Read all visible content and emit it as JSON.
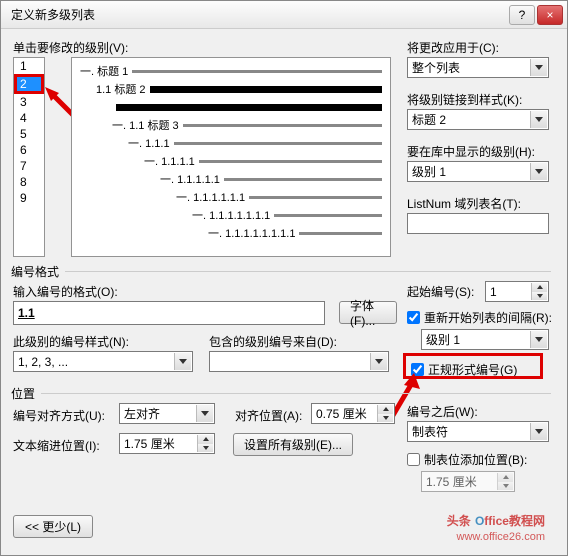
{
  "title": "定义新多级列表",
  "btn_help": "?",
  "btn_close": "×",
  "level_click_label": "单击要修改的级别(V):",
  "levels": [
    "1",
    "2",
    "3",
    "4",
    "5",
    "6",
    "7",
    "8",
    "9"
  ],
  "selected_level_index": 1,
  "preview": [
    {
      "indent": 0,
      "num": "一. 标题 1",
      "bold": false
    },
    {
      "indent": 1,
      "num": "1.1 标题 2",
      "bold": true
    },
    {
      "indent": 2,
      "num": "",
      "bold": true
    },
    {
      "indent": 2,
      "num": "一. 1.1 标题 3",
      "bold": false
    },
    {
      "indent": 3,
      "num": "一. 1.1.1",
      "bold": false
    },
    {
      "indent": 4,
      "num": "一. 1.1.1.1",
      "bold": false
    },
    {
      "indent": 5,
      "num": "一. 1.1.1.1.1",
      "bold": false
    },
    {
      "indent": 6,
      "num": "一. 1.1.1.1.1.1",
      "bold": false
    },
    {
      "indent": 7,
      "num": "一. 1.1.1.1.1.1.1",
      "bold": false
    },
    {
      "indent": 8,
      "num": "一. 1.1.1.1.1.1.1.1",
      "bold": false
    }
  ],
  "apply_to_label": "将更改应用于(C):",
  "apply_to_value": "整个列表",
  "link_style_label": "将级别链接到样式(K):",
  "link_style_value": "标题 2",
  "gallery_label": "要在库中显示的级别(H):",
  "gallery_value": "级别 1",
  "listnum_label": "ListNum 域列表名(T):",
  "listnum_value": "",
  "group_format": "编号格式",
  "num_format_label": "输入编号的格式(O):",
  "num_format_value": "1.1",
  "font_btn": "字体(F)...",
  "num_style_label": "此级别的编号样式(N):",
  "num_style_value": "1, 2, 3, ...",
  "include_from_label": "包含的级别编号来自(D):",
  "include_from_value": "",
  "start_at_label": "起始编号(S):",
  "start_at_value": "1",
  "restart_label": "重新开始列表的间隔(R):",
  "restart_value": "级别 1",
  "legal_label": "正规形式编号(G)",
  "group_pos": "位置",
  "align_label": "编号对齐方式(U):",
  "align_value": "左对齐",
  "align_at_label": "对齐位置(A):",
  "align_at_value": "0.75 厘米",
  "indent_label": "文本缩进位置(I):",
  "indent_value": "1.75 厘米",
  "set_all_btn": "设置所有级别(E)...",
  "follow_label": "编号之后(W):",
  "follow_value": "制表符",
  "tab_add_label": "制表位添加位置(B):",
  "tab_add_value": "1.75 厘米",
  "less_btn": "<< 更少(L)",
  "wm1": "头条",
  "wm_logo1": "O",
  "wm_logo2": "ffice",
  "wm3": "教程网",
  "wm_url": "www.office26.com"
}
